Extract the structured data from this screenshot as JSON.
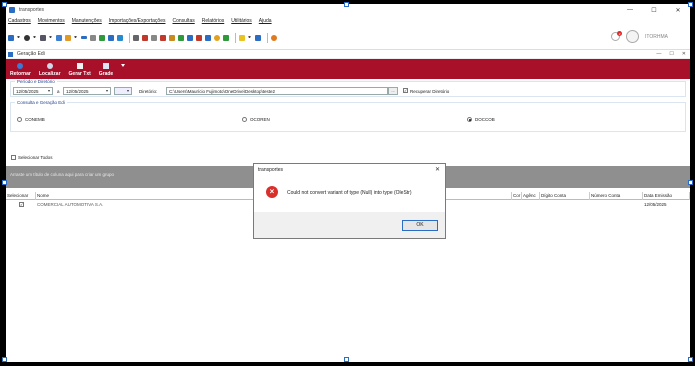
{
  "window": {
    "title": "transportes",
    "minimize": "—",
    "maximize": "☐",
    "close": "✕"
  },
  "menu": [
    "Cadastros",
    "Movimentos",
    "Manutenções",
    "Importações/Exportações",
    "Consultas",
    "Relatórios",
    "Utilitários",
    "Ajuda"
  ],
  "user": {
    "badge": "2",
    "name": "ITORHMA"
  },
  "child": {
    "title": "Geração Edi"
  },
  "actions": {
    "retornar": "Retornar",
    "localizar": "Localizar",
    "gerar": "Gerar Txt",
    "grade": "Grade"
  },
  "period": {
    "legend": "Período e Diretório",
    "date_from": "12/05/2025",
    "sep": "a",
    "date_to": "12/05/2025",
    "dir_label": "Diretório:",
    "dir_value": "C:\\Users\\Maurício Fujimoto\\OneDrive\\Desktop\\teste2",
    "browse": "...",
    "recover_label": "Recuperar Diretório",
    "recover_checked": "✓"
  },
  "consulta": {
    "legend": "Consulta e Geração Edi",
    "options": [
      "CONEMB",
      "OCOREN",
      "DOCCOB"
    ],
    "selected": "DOCCOB"
  },
  "select_all": "Selecionar Todos",
  "group_hint": "Arraste um título de coluna aqui para criar um grupo",
  "grid": {
    "columns": [
      "Selecionar",
      "Nome",
      "Cor",
      "Agênc",
      "Dígito Conta",
      "Número Conta",
      "Data Emissão"
    ],
    "rows": [
      {
        "selected": "✓",
        "name": "COMERCIAL AUTOMOTIVA S.A.",
        "date": "12/05/2025"
      }
    ]
  },
  "dialog": {
    "title": "transportes",
    "close": "✕",
    "message": "Could not convert variant of type (Null) into type (OleStr)",
    "ok": "OK"
  }
}
